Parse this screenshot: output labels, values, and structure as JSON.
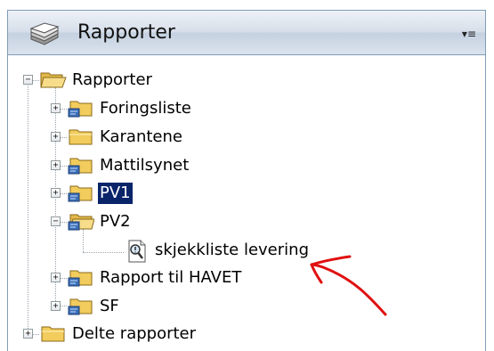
{
  "header": {
    "title": "Rapporter",
    "menu_glyph": "▾≡",
    "logo_icon": "books-stack-icon"
  },
  "tree": {
    "root": {
      "label": "Rapporter",
      "expander": "−",
      "icon": "folder-open-icon"
    },
    "children": [
      {
        "label": "Foringsliste",
        "expander": "+",
        "icon": "report-folder-icon"
      },
      {
        "label": "Karantene",
        "expander": "+",
        "icon": "folder-icon"
      },
      {
        "label": "Mattilsynet",
        "expander": "+",
        "icon": "report-folder-icon"
      },
      {
        "label": "PV1",
        "expander": "+",
        "icon": "report-folder-icon",
        "selected": true
      },
      {
        "label": "PV2",
        "expander": "−",
        "icon": "report-folder-open-icon"
      },
      {
        "label": "skjekkliste levering",
        "icon": "report-document-icon"
      },
      {
        "label": "Rapport til HAVET",
        "expander": "+",
        "icon": "report-folder-icon"
      },
      {
        "label": "SF",
        "expander": "+",
        "icon": "report-folder-icon"
      }
    ],
    "shared": {
      "label": "Delte rapporter",
      "expander": "+",
      "icon": "folder-icon"
    }
  },
  "annotation": {
    "color": "#e01010",
    "shape": "hand-drawn-arrow"
  }
}
